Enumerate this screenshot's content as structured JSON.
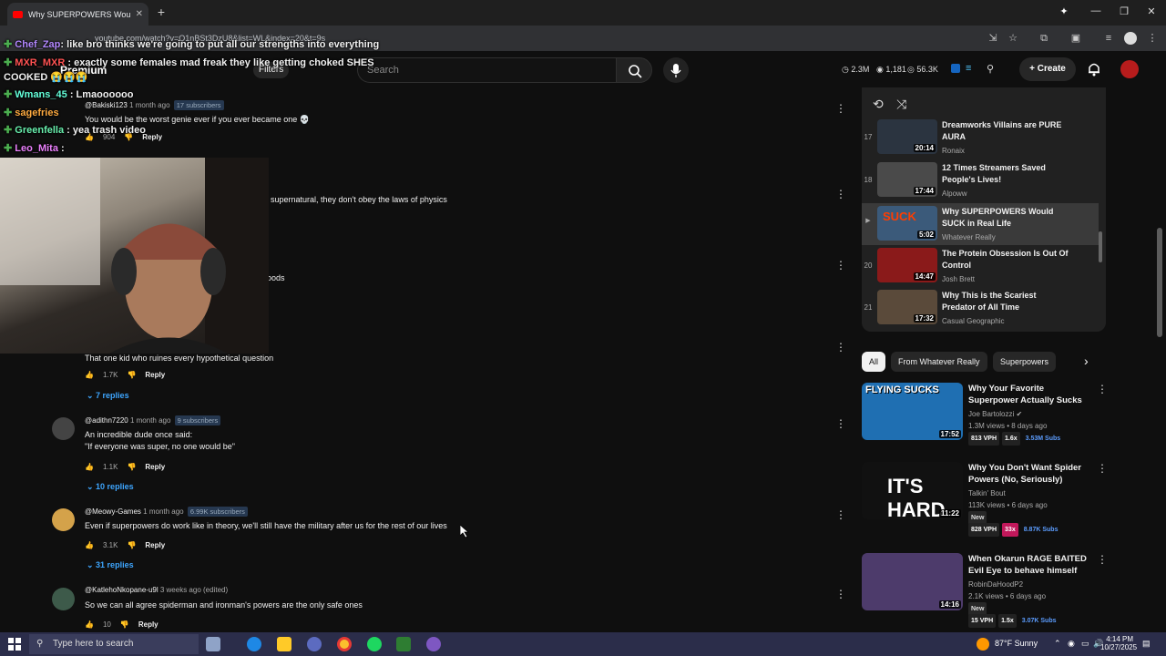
{
  "browser": {
    "tab_title": "Why SUPERPOWERS Would SU",
    "url": "youtube.com/watch?v=Q1nBSt3DzU8&list=WL&index=20&t=9s"
  },
  "youtube": {
    "premium_label": "Premium",
    "filters_label": "Filters",
    "search_placeholder": "Search",
    "stats": {
      "views": "2.3M",
      "count": "1,181",
      "subs": "56.3K"
    },
    "create_label": "Create"
  },
  "chat": [
    {
      "user": "Chef_Zap",
      "text": "like bro thinks we're going to put all our strengths into everything",
      "color": "#b388ff"
    },
    {
      "user": "MXR_MXR",
      "text": "exactly some females mad freak they like getting choked SHES",
      "color": "#ff5252"
    },
    {
      "user": "",
      "text": "COOKED",
      "color": "#ffffff"
    },
    {
      "user": "Wmans_45",
      "text": "Lmaoooooo",
      "color": "#64ffda"
    },
    {
      "user": "sagefries",
      "text": "",
      "color": "#ffab40"
    },
    {
      "user": "Greenfella",
      "text": "yea trash video",
      "color": "#69f0ae"
    },
    {
      "user": "Leo_Mita",
      "text": "",
      "color": "#ea80fc"
    }
  ],
  "comments": [
    {
      "handle": "@Bakiski123",
      "time": "1 month ago",
      "subs": "17 subscribers",
      "text": "You would be the worst genie ever if you ever became one 💀",
      "likes": "904",
      "reply": "Reply"
    },
    {
      "handle": "",
      "time": "",
      "subs": "",
      "text": "supernatural, they don't obey the laws of physics",
      "likes": "",
      "reply": ""
    },
    {
      "handle": "",
      "time": "",
      "subs": "",
      "text": "oods",
      "likes": "",
      "reply": ""
    },
    {
      "handle": "",
      "time": "",
      "subs": "",
      "text": "That one kid who ruines every hypothetical question",
      "likes": "1.7K",
      "reply": "Reply",
      "replies": "7 replies"
    },
    {
      "handle": "@adithn7220",
      "time": "1 month ago",
      "subs": "9 subscribers",
      "text": "An incredible dude once said:",
      "text2": "\"If everyone was super, no one would be\"",
      "likes": "1.1K",
      "reply": "Reply",
      "replies": "10 replies"
    },
    {
      "handle": "@Meowy-Games",
      "time": "1 month ago",
      "subs": "6.99K subscribers",
      "text": "Even if superpowers do work like in theory, we'll still have the military after us for the rest of our lives",
      "likes": "3.1K",
      "reply": "Reply",
      "replies": "31 replies"
    },
    {
      "handle": "@KatlehoNkopane-u9l",
      "time": "3 weeks ago (edited)",
      "subs": "",
      "text": "So we can all agree spiderman and ironman's powers are the only safe ones",
      "likes": "10",
      "reply": "Reply"
    }
  ],
  "playlist": [
    {
      "num": "17",
      "title": "Dreamworks Villains are PURE AURA",
      "channel": "Ronaix",
      "duration": "20:14",
      "color": "#2b3440"
    },
    {
      "num": "18",
      "title": "12 Times Streamers Saved People's Lives!",
      "channel": "Alpoww",
      "duration": "17:44",
      "color": "#4a4a4a"
    },
    {
      "num": "",
      "title": "Why SUPERPOWERS Would SUCK in Real Life",
      "channel": "Whatever Really",
      "duration": "5:02",
      "color": "#3b5a7a",
      "current": true
    },
    {
      "num": "20",
      "title": "The Protein Obsession Is Out Of Control",
      "channel": "Josh Brett",
      "duration": "14:47",
      "color": "#8a1a1a"
    },
    {
      "num": "21",
      "title": "Why This is the Scariest Predator of All Time",
      "channel": "Casual Geographic",
      "duration": "17:32",
      "color": "#5a4a3a"
    }
  ],
  "chips": [
    "All",
    "From Whatever Really",
    "Superpowers"
  ],
  "recommended": [
    {
      "title": "Why Your Favorite Superpower Actually Sucks",
      "channel": "Joe Bartolozzi",
      "meta": "1.3M views • 8 days ago",
      "duration": "17:52",
      "vph": "813 VPH",
      "mult": "1.6x",
      "subs": "3.53M Subs",
      "new": "",
      "thumb_text": "FLYING SUCKS",
      "color": "#1f6fb2"
    },
    {
      "title": "Why You Don't Want Spider Powers (No, Seriously)",
      "channel": "Talkin' Bout",
      "meta": "113K views • 6 days ago",
      "duration": "11:22",
      "vph": "828 VPH",
      "mult": "33x",
      "subs": "8.87K Subs",
      "new": "New",
      "thumb_text": "IT'S HARD",
      "color": "#111111"
    },
    {
      "title": "When Okarun RAGE BAITED Evil Eye to behave himself",
      "channel": "RobinDaHoodP2",
      "meta": "2.1K views • 6 days ago",
      "duration": "14:16",
      "vph": "15 VPH",
      "mult": "1.5x",
      "subs": "3.07K Subs",
      "new": "New",
      "thumb_text": "",
      "color": "#4d3b6b"
    }
  ],
  "taskbar": {
    "search_placeholder": "Type here to search",
    "weather": "87°F  Sunny",
    "time": "4:14 PM",
    "date": "10/27/2025"
  }
}
